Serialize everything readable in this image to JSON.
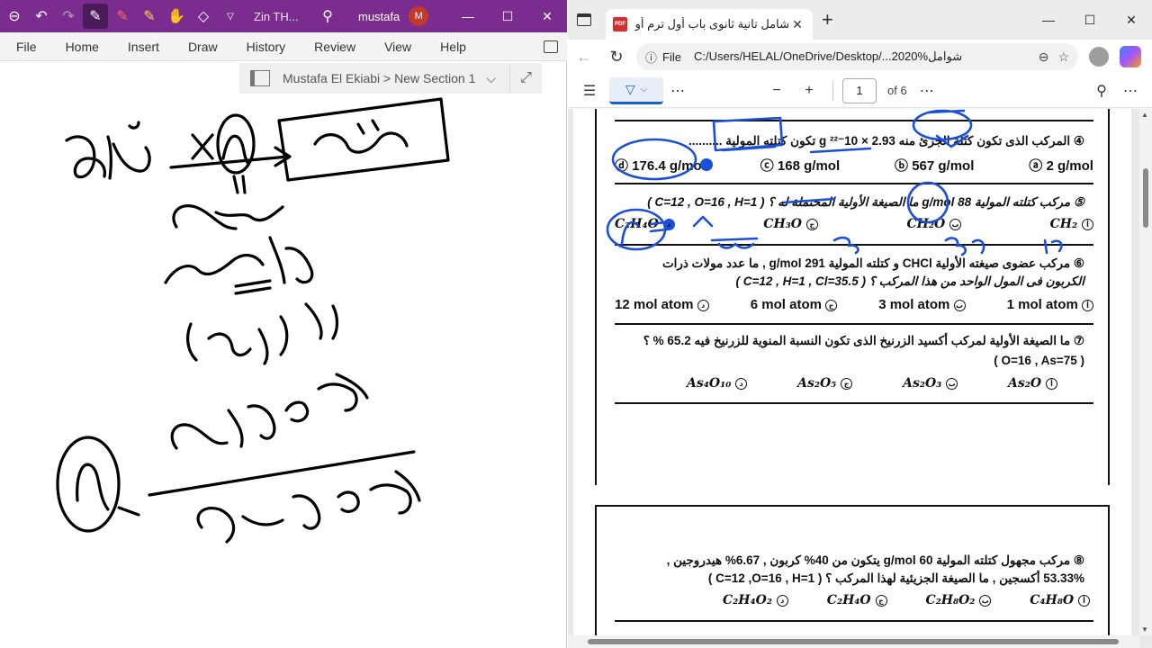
{
  "onenote": {
    "window_title": "Zin TH...",
    "user_name": "mustafa",
    "avatar_initial": "M",
    "ribbon_tabs": [
      "File",
      "Home",
      "Insert",
      "Draw",
      "History",
      "Review",
      "View",
      "Help"
    ],
    "breadcrumb": "Mustafa El Ekiabi > New Section 1"
  },
  "edge": {
    "tab_title": "شامل تانية ثانوى باب أول ترم أول.pdf*",
    "pdf_badge": "PDF",
    "url_scheme": "File",
    "url_path": "C:/Users/HELAL/OneDrive/Desktop/...2020%شوامل",
    "page_number": "1",
    "page_total": "of 6"
  },
  "pdf": {
    "q4": {
      "text": "④ المركب الذى تكون كتلة الجزئ منه 2.93 × 10⁻²² g تكون كتلته المولية ..........",
      "options": [
        "ⓐ 2 g/mol",
        "ⓑ 567 g/mol",
        "ⓒ 168 g/mol",
        "ⓓ 176.4 g/mol"
      ]
    },
    "q5": {
      "text": "⑤ مركب كتلته المولية 88 g/mol ما الصيغة الأولية المحتملة له ؟ ( C=12 , O=16 , H=1 )",
      "options": [
        "CH₂",
        "CH₂O",
        "CH₃O",
        "C₂H₄O"
      ]
    },
    "q6": {
      "line1": "⑥ مركب عضوى صيغته الأولية CHCl و كتلته المولية 291 g/mol , ما عدد مولات ذرات",
      "line2": "الكربون فى المول الواحد من هذا المركب ؟ ( C=12 , H=1 , Cl=35.5 )",
      "options": [
        "1 mol atom",
        "3 mol atom",
        "6 mol atom",
        "12 mol atom"
      ]
    },
    "q7": {
      "line1": "⑦ ما الصيغة الأولية لمركب أكسيد الزرنيخ الذى تكون النسبة المنوية للزرنيخ فيه 65.2 % ؟",
      "line2": "( O=16 , As=75 )",
      "options": [
        "As₂O",
        "As₂O₃",
        "As₂O₅",
        "As₄O₁₀"
      ]
    },
    "q8": {
      "line1": "⑧ مركب مجهول كتلته المولية 60 g/mol يتكون من 40% كربون , 6.67% هيدروجين ,",
      "line2": "53.33% أكسجين , ما الصيغة الجزيئية لهذا المركب ؟ ( C=12 ,O=16 , H=1 )",
      "options": [
        "C₄H₈O",
        "C₂H₈O₂",
        "C₂H₄O",
        "C₂H₄O₂"
      ]
    },
    "option_letters": [
      "ⓐ",
      "ⓑ",
      "ⓒ",
      "ⓓ"
    ]
  },
  "colors": {
    "onenote_purple": "#7a2d8f",
    "edge_accent": "#1a5fd0",
    "pen_ink": "#1a4fd8"
  },
  "icons": [
    "back-icon",
    "undo-icon",
    "redo-icon",
    "pen-icon",
    "hand-icon",
    "eraser-icon",
    "search-icon",
    "minimize-icon",
    "maximize-icon",
    "close-icon",
    "refresh-icon",
    "zoom-icon",
    "star-icon"
  ]
}
